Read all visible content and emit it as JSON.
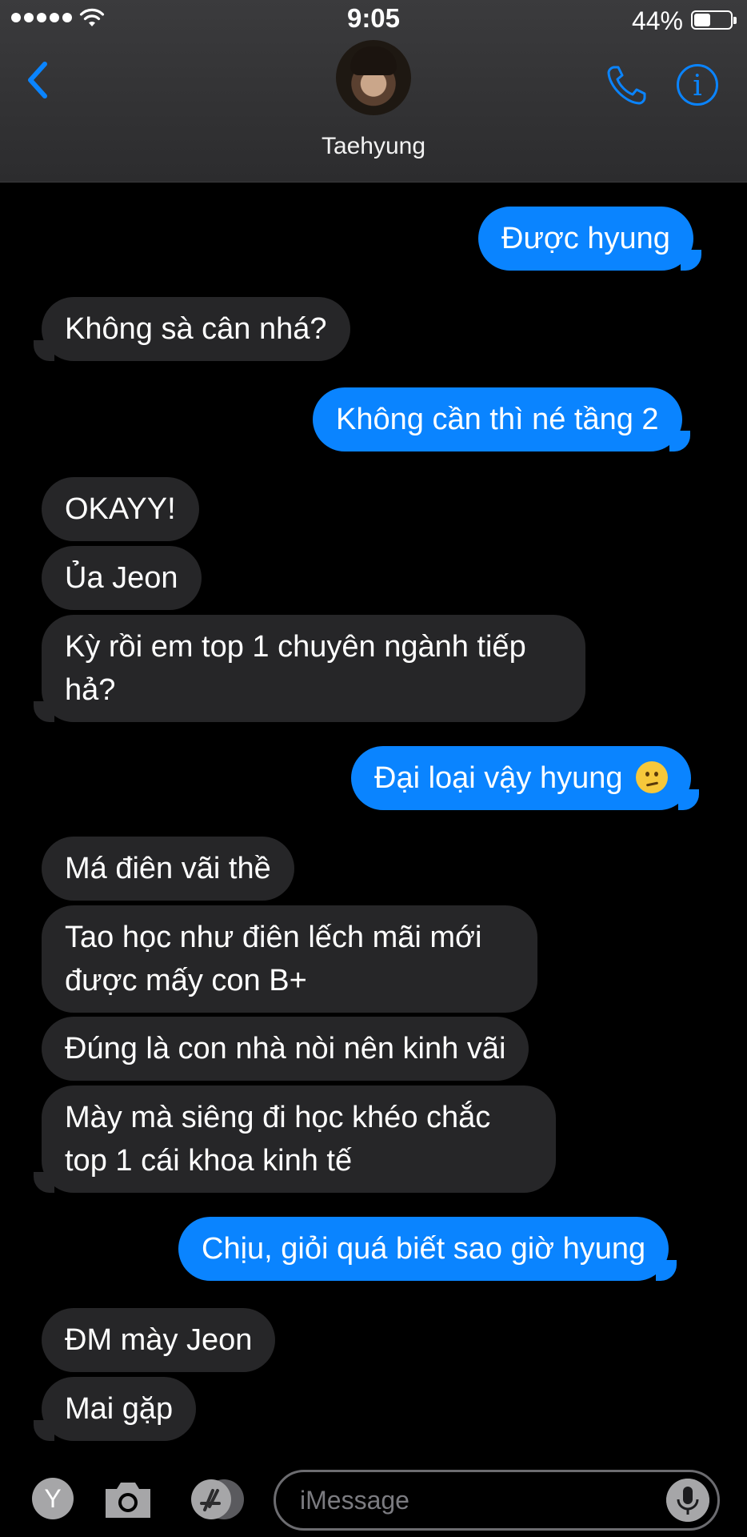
{
  "status": {
    "time": "9:05",
    "battery_percent": "44%",
    "battery_level": 0.44,
    "signal_dots": 5
  },
  "header": {
    "contact_name": "Taehyung",
    "icons": {
      "back": "chevron-left-icon",
      "call": "phone-icon",
      "info": "info-icon"
    },
    "info_glyph": "i"
  },
  "messages": [
    {
      "from": "me",
      "text": "Được hyung"
    },
    {
      "from": "them",
      "text": "Không sà cân nhá?"
    },
    {
      "from": "me",
      "text": "Không cần thì né tầng 2"
    },
    {
      "from": "them",
      "text": "OKAYY!"
    },
    {
      "from": "them",
      "text": "Ủa Jeon"
    },
    {
      "from": "them",
      "text": "Kỳ rồi em top 1 chuyên ngành tiếp hả?"
    },
    {
      "from": "me",
      "text": "Đại loại vậy hyung",
      "emoji": "confused-face"
    },
    {
      "from": "them",
      "text": "Má điên vãi thề"
    },
    {
      "from": "them",
      "text": "Tao học như điên lếch mãi mới được mấy con B+"
    },
    {
      "from": "them",
      "text": "Đúng là con nhà nòi nên kinh vãi"
    },
    {
      "from": "them",
      "text": "Mày mà siêng đi học khéo chắc top 1 cái khoa kinh tế"
    },
    {
      "from": "me",
      "text": "Chịu, giỏi quá biết sao giờ hyung"
    },
    {
      "from": "them",
      "text": "ĐM mày Jeon"
    },
    {
      "from": "them",
      "text": "Mai gặp"
    }
  ],
  "toolbar": {
    "placeholder": "iMessage",
    "appstore_glyph": "Y",
    "icons": {
      "appstore": "app-store-icon",
      "camera": "camera-icon",
      "apps": "apps-icon",
      "mic": "microphone-icon"
    }
  },
  "colors": {
    "outgoing_bubble": "#0a84ff",
    "incoming_bubble": "#262628",
    "background": "#000000",
    "accent": "#0a84ff"
  }
}
